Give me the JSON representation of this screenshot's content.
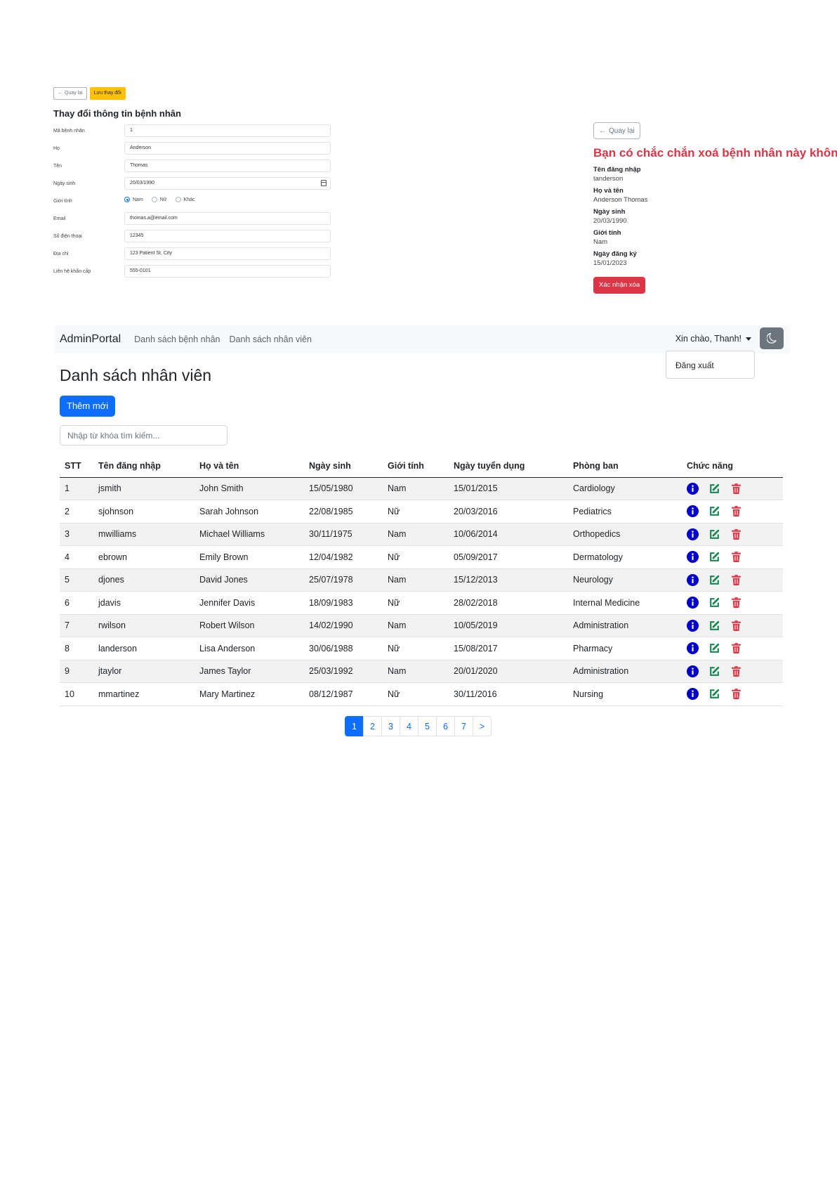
{
  "edit_form": {
    "back_label": "Quay lại",
    "save_label": "Lưu thay đổi",
    "title": "Thay đổi thông tin bệnh nhân",
    "fields": [
      {
        "label": "Mã bệnh nhân",
        "value": "1"
      },
      {
        "label": "Họ",
        "value": "Anderson"
      },
      {
        "label": "Tên",
        "value": "Thomas"
      },
      {
        "label": "Ngày sinh",
        "value": "20/03/1990"
      },
      {
        "label": "Giới tính"
      },
      {
        "label": "Email",
        "value": "thomas.a@email.com"
      },
      {
        "label": "Số điện thoại",
        "value": "12345"
      },
      {
        "label": "Địa chỉ",
        "value": "123 Patient St, City"
      },
      {
        "label": "Liên hệ khẩn cấp",
        "value": "555-0101"
      }
    ],
    "gender_options": [
      "Nam",
      "Nữ",
      "Khác"
    ],
    "gender_selected": "Nam"
  },
  "delete_confirm": {
    "back_label": "Quay lại",
    "title": "Bạn có chắc chắn xoá bệnh nhân này không",
    "items": [
      {
        "term": "Tên đăng nhập",
        "value": "tanderson"
      },
      {
        "term": "Họ và tên",
        "value": "Anderson Thomas"
      },
      {
        "term": "Ngày sinh",
        "value": "20/03/1990"
      },
      {
        "term": "Giới tính",
        "value": "Nam"
      },
      {
        "term": "Ngày đăng ký",
        "value": "15/01/2023"
      }
    ],
    "confirm_label": "Xác nhận xóa"
  },
  "navbar": {
    "brand": "AdminPortal",
    "links": [
      "Danh sách bệnh nhân",
      "Danh sách nhân viên"
    ],
    "greeting": "Xin chào, Thanh!",
    "dropdown_item": "Đăng xuất"
  },
  "employees": {
    "title": "Danh sách nhân viên",
    "add_label": "Thêm mới",
    "search_placeholder": "Nhập từ khóa tìm kiếm...",
    "columns": [
      "STT",
      "Tên đăng nhập",
      "Họ và tên",
      "Ngày sinh",
      "Giới tính",
      "Ngày tuyển dụng",
      "Phòng ban",
      "Chức năng"
    ],
    "rows": [
      [
        "1",
        "jsmith",
        "John Smith",
        "15/05/1980",
        "Nam",
        "15/01/2015",
        "Cardiology"
      ],
      [
        "2",
        "sjohnson",
        "Sarah Johnson",
        "22/08/1985",
        "Nữ",
        "20/03/2016",
        "Pediatrics"
      ],
      [
        "3",
        "mwilliams",
        "Michael Williams",
        "30/11/1975",
        "Nam",
        "10/06/2014",
        "Orthopedics"
      ],
      [
        "4",
        "ebrown",
        "Emily Brown",
        "12/04/1982",
        "Nữ",
        "05/09/2017",
        "Dermatology"
      ],
      [
        "5",
        "djones",
        "David Jones",
        "25/07/1978",
        "Nam",
        "15/12/2013",
        "Neurology"
      ],
      [
        "6",
        "jdavis",
        "Jennifer Davis",
        "18/09/1983",
        "Nữ",
        "28/02/2018",
        "Internal Medicine"
      ],
      [
        "7",
        "rwilson",
        "Robert Wilson",
        "14/02/1990",
        "Nam",
        "10/05/2019",
        "Administration"
      ],
      [
        "8",
        "landerson",
        "Lisa Anderson",
        "30/06/1988",
        "Nữ",
        "15/08/2017",
        "Pharmacy"
      ],
      [
        "9",
        "jtaylor",
        "James Taylor",
        "25/03/1992",
        "Nam",
        "20/01/2020",
        "Administration"
      ],
      [
        "10",
        "mmartinez",
        "Mary Martinez",
        "08/12/1987",
        "Nữ",
        "30/11/2016",
        "Nursing"
      ]
    ],
    "pagination": [
      "1",
      "2",
      "3",
      "4",
      "5",
      "6",
      "7",
      ">"
    ],
    "current_page": "1"
  },
  "colors": {
    "primary": "#0d6efd",
    "danger": "#dc3545",
    "success": "#198754",
    "warning": "#ffc107",
    "info_icon": "#0000cc"
  }
}
